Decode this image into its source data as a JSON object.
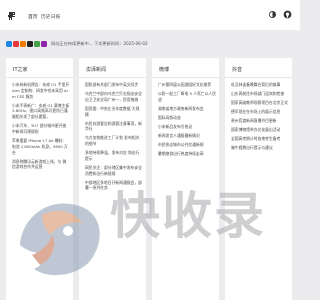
{
  "header": {
    "nav": [
      "首页",
      "历史日报"
    ]
  },
  "notice": {
    "text": "网站正在持续更新中...  下次更新时间：2025-06-02"
  },
  "columns": [
    {
      "title": "IT之家",
      "items": [
        "小米有新机预告：玄戒 O1 手里开 Arm 定制的、研发中也未采用 Arm CSS 服务",
        "小米手表新广：玄戒 O1 赛博主板 3.8GHz、图口高频高可靠防已通服相关发了部分要管，",
        "小米汽车、YU7 部分城市更开放中新闻可预规则",
        "苹果重要 iPhone 17 Air 曝料：电池 2,800mAh 机身，5690 万台",
        "消息称腾讯云新游戏上线，与 微信游戏合作共运营"
      ]
    },
    {
      "title": "澎湃新闻",
      "items": [
        "国防部有关部门发布中英文同步",
        "乌克兰中部向乌克兰打击指出安全自卫卫安全局广州一，民用措施",
        "国资委：中央企业年度数据 大规模",
        "市民向游客告知游客注意事项，新华社",
        "乌方加快推进工厂计划 发布相关的细节",
        "多地持续降温，发布对应 和出行提示",
        "网民关注：部分地区集中发布安全 消费和出行新规规",
        "中部地区多地召开新闻通报会，部署一系列任务"
      ]
    },
    {
      "title": "微博",
      "items": [
        "广州第四届公园游园好文化推荐",
        "以防一起工厂断电 5 人死亡以人民 战",
        "湖南省地方政府新闻发布会",
        "国际局势动态",
        "小米新品发布引热议",
        "新闻发言人通报最新情况",
        "市民热议城市公共交通新规",
        "暑期旅游出行热度持续走高"
      ]
    },
    {
      "title": "抖音",
      "items": [
        "巩汉林谈春晚舞台背后的故事",
        "山东再前往市场部门迎宾和检查",
        "国家高级教师观察项目在北京正式",
        "德军现在在市场上的展示信息",
        "贵州官渡新闻直播节目更新",
        "国家博物馆举办文化展出活动",
        "全国高考倒计时各地考生备考",
        "端午假期出行提示与建议"
      ]
    }
  ]
}
